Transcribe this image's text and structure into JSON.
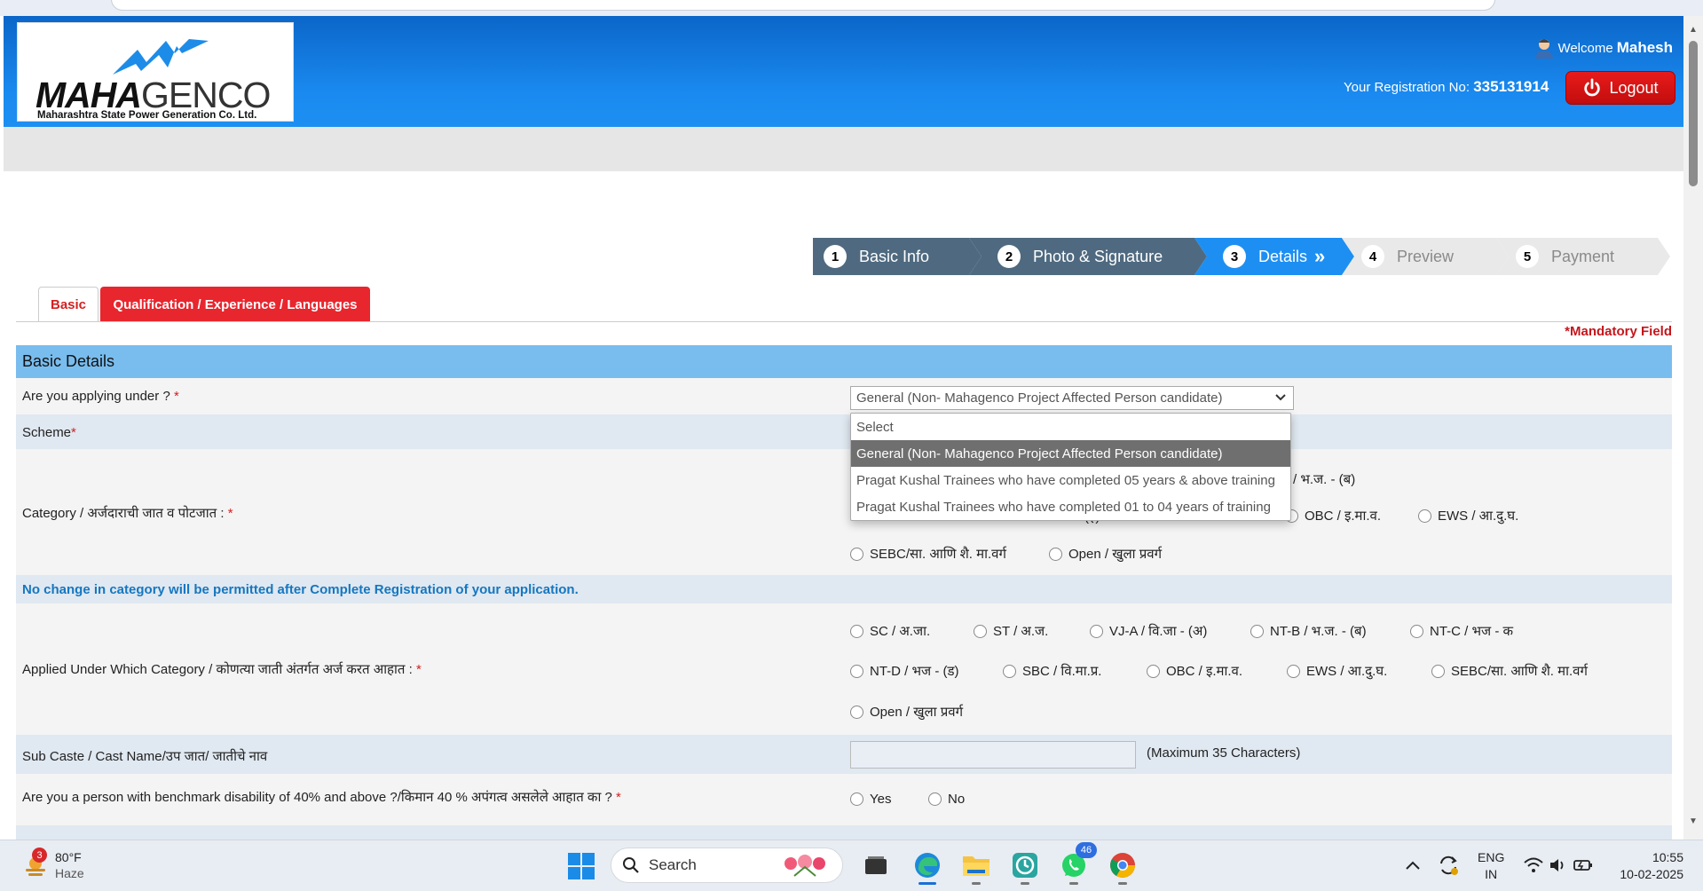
{
  "header": {
    "logo_name_bold": "MAHA",
    "logo_name_light": "GENCO",
    "logo_subtitle": "Maharashtra State Power Generation Co. Ltd.",
    "welcome_label": "Welcome",
    "user_name": "Mahesh",
    "registration_label": "Your Registration No:",
    "registration_no": "335131914",
    "logout_label": "Logout"
  },
  "stepper": [
    {
      "num": "1",
      "label": "Basic Info"
    },
    {
      "num": "2",
      "label": "Photo & Signature"
    },
    {
      "num": "3",
      "label": "Details"
    },
    {
      "num": "4",
      "label": "Preview"
    },
    {
      "num": "5",
      "label": "Payment"
    }
  ],
  "tabs": {
    "basic": "Basic",
    "qualification": "Qualification / Experience / Languages"
  },
  "mandatory_note": "*Mandatory Field",
  "section_title": "Basic Details",
  "form": {
    "applying_under_label": "Are you applying under ?",
    "applying_under_value": "General (Non- Mahagenco Project Affected Person candidate)",
    "scheme_label": "Scheme",
    "category_label": "Category / अर्जदाराची जात व पोटजात :",
    "category_options_visible": [
      "/ भ.ज. - (ब)",
      "OBC / इ.मा.व.",
      "EWS / आ.दु.घ.",
      "SEBC/सा. आणि शै. मा.वर्ग",
      "Open / खुला प्रवर्ग"
    ],
    "category_partial": "(इ)",
    "category_note": "No change in category will be permitted after Complete Registration of your application.",
    "applied_category_label": "Applied Under Which Category / कोणत्या जाती अंतर्गत अर्ज करत आहात :",
    "applied_category_options": [
      "SC / अ.जा.",
      "ST / अ.ज.",
      "VJ-A / वि.जा - (अ)",
      "NT-B / भ.ज. - (ब)",
      "NT-C / भज - क",
      "NT-D / भज - (ड)",
      "SBC / वि.मा.प्र.",
      "OBC / इ.मा.व.",
      "EWS / आ.दु.घ.",
      "SEBC/सा. आणि शै. मा.वर्ग",
      "Open / खुला प्रवर्ग"
    ],
    "subcaste_label": "Sub Caste / Cast Name/उप जात/ जातीचे नाव",
    "subcaste_max_note": "(Maximum 35 Characters)",
    "disability_label": "Are you a person with benchmark disability of 40% and above ?/किमान 40 % अपंगत्व असलेले आहात का ?",
    "disability_options": [
      "Yes",
      "No"
    ]
  },
  "dropdown": {
    "options": [
      "Select",
      "General (Non- Mahagenco Project Affected Person candidate)",
      "Pragat Kushal Trainees who have completed 05 years & above training",
      "Pragat Kushal Trainees who have completed 01 to 04 years of training"
    ],
    "selected_index": 1
  },
  "taskbar": {
    "weather_badge": "3",
    "temperature": "80°F",
    "weather_condition": "Haze",
    "search_label": "Search",
    "whatsapp_badge": "46",
    "lang_line1": "ENG",
    "lang_line2": "IN",
    "time": "10:55",
    "date": "10-02-2025"
  },
  "colors": {
    "header_blue": "#1a8af0",
    "step_dark": "#4f6a80",
    "step_active": "#1d8ff2",
    "step_inactive": "#e9e9e9",
    "tab_red": "#e8262e",
    "section_blue": "#79bdee",
    "note_blue": "#1577c0"
  }
}
